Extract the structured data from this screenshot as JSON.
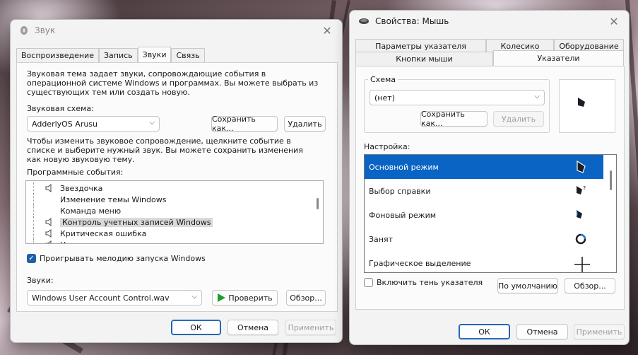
{
  "sound_window": {
    "title": "Звук",
    "tabs": [
      "Воспроизведение",
      "Запись",
      "Звуки",
      "Связь"
    ],
    "description": "Звуковая тема задает звуки, сопровождающие события в операционной системе Windows и программах. Вы можете выбрать из существующих тем или создать новую.",
    "scheme_label": "Звуковая схема:",
    "scheme_value": "AdderlyOS Arusu",
    "save_as_button": "Сохранить как...",
    "delete_button": "Удалить",
    "change_hint": "Чтобы изменить звуковое сопровождение, щелкните событие в списке и выберите нужный звук. Вы можете сохранить изменения как новую звуковую тему.",
    "events_label": "Программные события:",
    "events": [
      {
        "label": "Звездочка",
        "has_sound": true
      },
      {
        "label": "Изменение темы Windows",
        "has_sound": false
      },
      {
        "label": "Команда меню",
        "has_sound": false
      },
      {
        "label": "Контроль учетных записей Windows",
        "has_sound": true,
        "highlighted": true
      },
      {
        "label": "Критическая ошибка",
        "has_sound": true
      },
      {
        "label": "Напоминание календаря",
        "has_sound": true
      }
    ],
    "startup_checkbox": "Проигрывать мелодию запуска Windows",
    "startup_checked": true,
    "sounds_label": "Звуки:",
    "sound_file": "Windows User Account Control.wav",
    "test_button": "Проверить",
    "browse_button": "Обзор...",
    "ok_button": "ОК",
    "cancel_button": "Отмена",
    "apply_button": "Применить"
  },
  "mouse_window": {
    "title": "Свойства: Мышь",
    "tabs_row1": [
      "Параметры указателя",
      "Колесико",
      "Оборудование"
    ],
    "tabs_row2": [
      "Кнопки мыши",
      "Указатели"
    ],
    "scheme_group_label": "Схема",
    "scheme_value": "(нет)",
    "save_as_button": "Сохранить как...",
    "delete_button": "Удалить",
    "settings_label": "Настройка:",
    "pointers": [
      {
        "label": "Основной режим",
        "icon": "arrow-pointer-icon",
        "selected": true
      },
      {
        "label": "Выбор справки",
        "icon": "help-pointer-icon"
      },
      {
        "label": "Фоновый режим",
        "icon": "working-pointer-icon"
      },
      {
        "label": "Занят",
        "icon": "busy-ring-icon"
      },
      {
        "label": "Графическое выделение",
        "icon": "crosshair-icon"
      }
    ],
    "shadow_checkbox": "Включить тень указателя",
    "shadow_checked": false,
    "default_button": "По умолчанию",
    "browse_button": "Обзор...",
    "ok_button": "ОК",
    "cancel_button": "Отмена",
    "apply_button": "Применить"
  }
}
